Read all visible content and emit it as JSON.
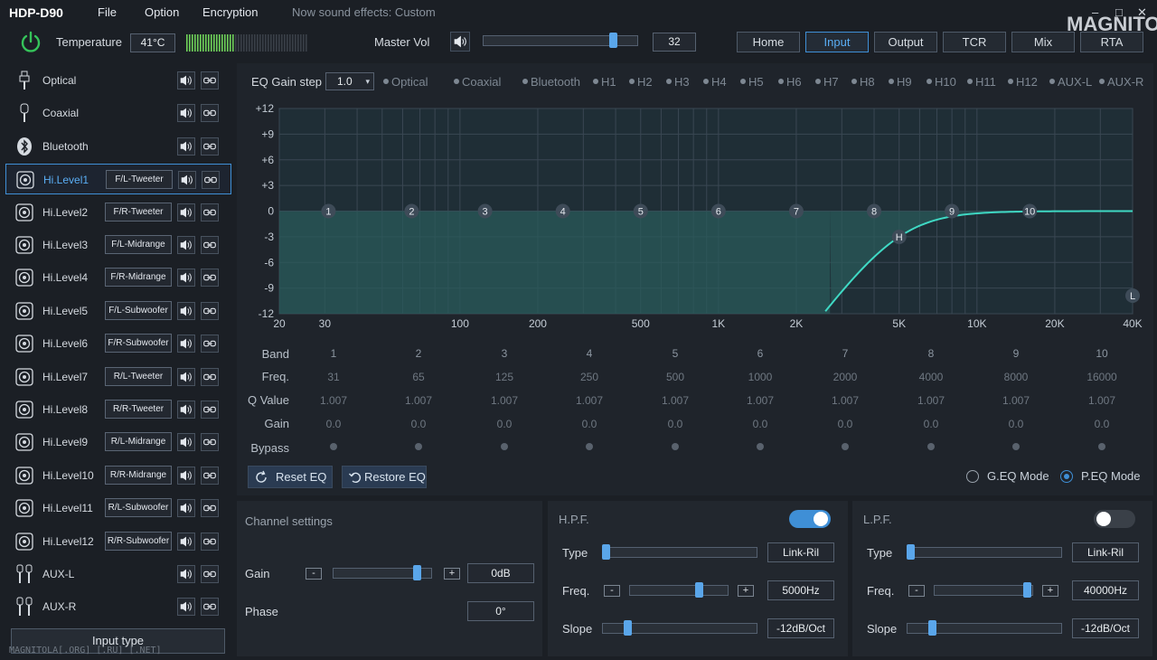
{
  "app": {
    "title": "HDP-D90",
    "menu": [
      "File",
      "Option",
      "Encryption"
    ],
    "sound_effect": "Now sound effects: Custom",
    "logo": "MAGNITOLA",
    "window": {
      "minimize": "–",
      "maximize": "□",
      "close": "✕"
    }
  },
  "top": {
    "temperature_label": "Temperature",
    "temperature": "41°C",
    "master_vol_label": "Master Vol",
    "master_vol": "32",
    "master_vol_level": 0.86,
    "nav": [
      "Home",
      "Input",
      "Output",
      "TCR",
      "Mix",
      "RTA"
    ],
    "nav_active": "Input"
  },
  "channels": [
    {
      "name": "Optical",
      "tag": "",
      "icon": "optical-icon"
    },
    {
      "name": "Coaxial",
      "tag": "",
      "icon": "coaxial-icon"
    },
    {
      "name": "Bluetooth",
      "tag": "",
      "icon": "bluetooth-icon"
    },
    {
      "name": "Hi.Level1",
      "tag": "F/L-Tweeter",
      "icon": "speaker-icon",
      "selected": true
    },
    {
      "name": "Hi.Level2",
      "tag": "F/R-Tweeter",
      "icon": "speaker-icon"
    },
    {
      "name": "Hi.Level3",
      "tag": "F/L-Midrange",
      "icon": "speaker-icon"
    },
    {
      "name": "Hi.Level4",
      "tag": "F/R-Midrange",
      "icon": "speaker-icon"
    },
    {
      "name": "Hi.Level5",
      "tag": "F/L-Subwoofer",
      "icon": "speaker-icon"
    },
    {
      "name": "Hi.Level6",
      "tag": "F/R-Subwoofer",
      "icon": "speaker-icon"
    },
    {
      "name": "Hi.Level7",
      "tag": "R/L-Tweeter",
      "icon": "speaker-icon"
    },
    {
      "name": "Hi.Level8",
      "tag": "R/R-Tweeter",
      "icon": "speaker-icon"
    },
    {
      "name": "Hi.Level9",
      "tag": "R/L-Midrange",
      "icon": "speaker-icon"
    },
    {
      "name": "Hi.Level10",
      "tag": "R/R-Midrange",
      "icon": "speaker-icon"
    },
    {
      "name": "Hi.Level11",
      "tag": "R/L-Subwoofer",
      "icon": "speaker-icon"
    },
    {
      "name": "Hi.Level12",
      "tag": "R/R-Subwoofer",
      "icon": "speaker-icon"
    },
    {
      "name": "AUX-L",
      "tag": "",
      "icon": "rca-icon"
    },
    {
      "name": "AUX-R",
      "tag": "",
      "icon": "rca-icon"
    }
  ],
  "input_type_label": "Input type",
  "watermark": "MAGNITOLA[.ORG] [.RU] [.NET]",
  "eq": {
    "gain_step_label": "EQ Gain step",
    "gain_step": "1.0",
    "sources": [
      "Optical",
      "Coaxial",
      "Bluetooth",
      "H1",
      "H2",
      "H3",
      "H4",
      "H5",
      "H6",
      "H7",
      "H8",
      "H9",
      "H10",
      "H11",
      "H12",
      "AUX-L",
      "AUX-R"
    ],
    "y_ticks": [
      "+12",
      "+9",
      "+6",
      "+3",
      "0",
      "-3",
      "-6",
      "-9",
      "-12"
    ],
    "x_ticks": [
      {
        "f": 20,
        "l": "20"
      },
      {
        "f": 30,
        "l": "30"
      },
      {
        "f": 100,
        "l": "100"
      },
      {
        "f": 200,
        "l": "200"
      },
      {
        "f": 500,
        "l": "500"
      },
      {
        "f": 1000,
        "l": "1K"
      },
      {
        "f": 2000,
        "l": "2K"
      },
      {
        "f": 5000,
        "l": "5K"
      },
      {
        "f": 10000,
        "l": "10K"
      },
      {
        "f": 20000,
        "l": "20K"
      },
      {
        "f": 40000,
        "l": "40K"
      }
    ],
    "hpf_marker": "H",
    "lpf_marker": "L",
    "row_labels": {
      "band": "Band",
      "freq": "Freq.",
      "q": "Q Value",
      "gain": "Gain",
      "bypass": "Bypass"
    },
    "bands": [
      {
        "band": "1",
        "freq": "31",
        "q": "1.007",
        "gain": "0.0"
      },
      {
        "band": "2",
        "freq": "65",
        "q": "1.007",
        "gain": "0.0"
      },
      {
        "band": "3",
        "freq": "125",
        "q": "1.007",
        "gain": "0.0"
      },
      {
        "band": "4",
        "freq": "250",
        "q": "1.007",
        "gain": "0.0"
      },
      {
        "band": "5",
        "freq": "500",
        "q": "1.007",
        "gain": "0.0"
      },
      {
        "band": "6",
        "freq": "1000",
        "q": "1.007",
        "gain": "0.0"
      },
      {
        "band": "7",
        "freq": "2000",
        "q": "1.007",
        "gain": "0.0"
      },
      {
        "band": "8",
        "freq": "4000",
        "q": "1.007",
        "gain": "0.0"
      },
      {
        "band": "9",
        "freq": "8000",
        "q": "1.007",
        "gain": "0.0"
      },
      {
        "band": "10",
        "freq": "16000",
        "q": "1.007",
        "gain": "0.0"
      }
    ],
    "reset_label": "Reset EQ",
    "restore_label": "Restore EQ",
    "geq_label": "G.EQ Mode",
    "peq_label": "P.EQ Mode",
    "mode": "P.EQ"
  },
  "channel_settings": {
    "title": "Channel settings",
    "gain_label": "Gain",
    "gain": "0dB",
    "gain_level": 0.88,
    "phase_label": "Phase",
    "phase": "0°"
  },
  "hpf": {
    "title": "H.P.F.",
    "enabled": true,
    "type_label": "Type",
    "type": "Link-Ril",
    "type_level": 0.0,
    "freq_label": "Freq.",
    "freq": "5000Hz",
    "freq_level": 0.72,
    "slope_label": "Slope",
    "slope": "-12dB/Oct",
    "slope_level": 0.15
  },
  "lpf": {
    "title": "L.P.F.",
    "enabled": false,
    "type_label": "Type",
    "type": "Link-Ril",
    "type_level": 0.0,
    "freq_label": "Freq.",
    "freq": "40000Hz",
    "freq_level": 0.98,
    "slope_label": "Slope",
    "slope": "-12dB/Oct",
    "slope_level": 0.15
  }
}
